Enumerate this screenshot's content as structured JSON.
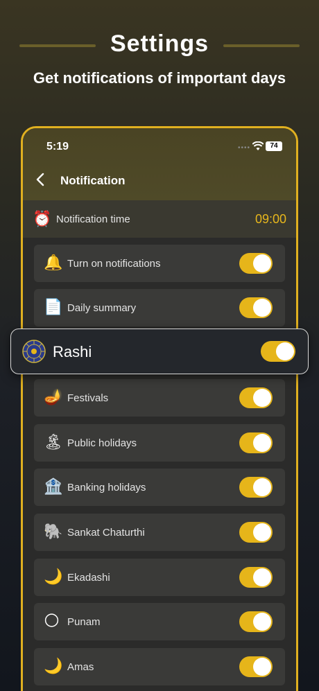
{
  "hero": {
    "title": "Settings",
    "subtitle": "Get notifications of important days"
  },
  "status_bar": {
    "time": "5:19",
    "battery": "74"
  },
  "nav": {
    "title": "Notification"
  },
  "notification_time": {
    "label": "Notification time",
    "value": "09:00",
    "icon": "clock-icon"
  },
  "rows": [
    {
      "label": "Turn on notifications",
      "icon": "bell-icon",
      "glyph": "🔔",
      "on": true
    },
    {
      "label": "Daily summary",
      "icon": "document-icon",
      "glyph": "📄",
      "on": true
    },
    {
      "label": "Festivals",
      "icon": "diya-icon",
      "glyph": "🪔",
      "on": true
    },
    {
      "label": "Public holidays",
      "icon": "palm-tree-icon",
      "glyph": "🏝",
      "on": true
    },
    {
      "label": "Banking holidays",
      "icon": "bank-icon",
      "glyph": "🏦",
      "on": true
    },
    {
      "label": "Sankat Chaturthi",
      "icon": "ganesha-icon",
      "glyph": "🐘",
      "on": true
    },
    {
      "label": "Ekadashi",
      "icon": "moon-icon",
      "glyph": "🌙",
      "on": true
    },
    {
      "label": "Punam",
      "icon": "full-moon-icon",
      "glyph": "🌕",
      "on": true
    },
    {
      "label": "Amas",
      "icon": "crescent-moon-icon",
      "glyph": "🌙",
      "on": true
    }
  ],
  "rashi": {
    "label": "Rashi",
    "icon": "zodiac-wheel-icon",
    "on": true
  },
  "colors": {
    "accent": "#e6b51a",
    "frame": "#e0b020",
    "row_bg": "#3a3a38"
  }
}
